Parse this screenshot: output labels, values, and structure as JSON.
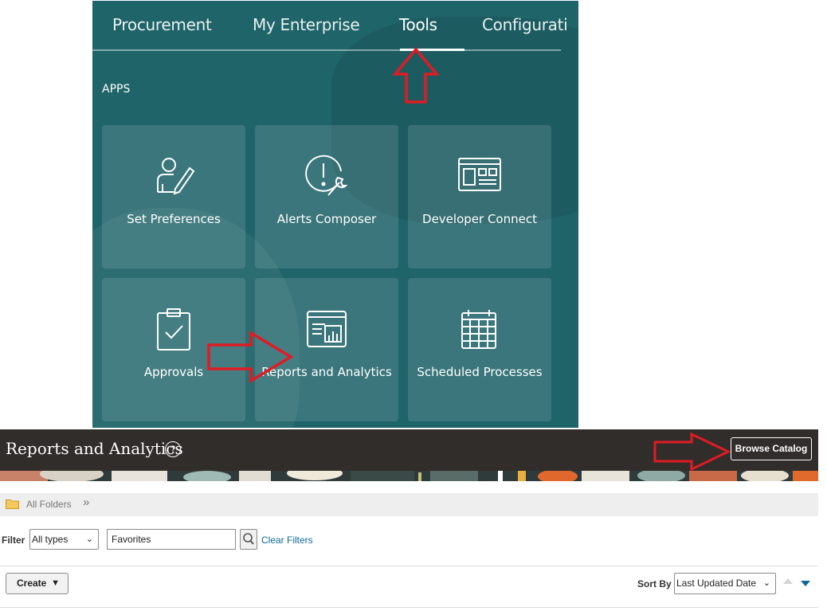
{
  "springboard": {
    "tabs": [
      "Procurement",
      "My Enterprise",
      "Tools",
      "Configurati"
    ],
    "active_tab": "Tools",
    "section_label": "APPS",
    "tiles": [
      {
        "label": "Set Preferences",
        "icon": "person-pencil-icon"
      },
      {
        "label": "Alerts Composer",
        "icon": "alert-wrench-icon"
      },
      {
        "label": "Developer Connect",
        "icon": "browser-window-icon"
      },
      {
        "label": "Approvals",
        "icon": "clipboard-check-icon"
      },
      {
        "label": "Reports and Analytics",
        "icon": "report-chart-icon"
      },
      {
        "label": "Scheduled Processes",
        "icon": "calendar-grid-icon"
      }
    ]
  },
  "reports": {
    "title": "Reports and Analytics",
    "help_glyph": "?",
    "browse_catalog_label": "Browse Catalog",
    "breadcrumb": "All Folders",
    "breadcrumb_chevron": "»",
    "filter_label": "Filter",
    "type_select_value": "All types",
    "filter_input_value": "Favorites",
    "clear_filters_label": "Clear Filters",
    "create_label": "Create",
    "sort_by_label": "Sort By",
    "sort_by_value": "Last Updated Date"
  },
  "colors": {
    "springboard_bg": "#1f6469",
    "header_bg": "#312d2a",
    "annotation_arrow": "#e01b24",
    "link": "#0b6a9a"
  }
}
